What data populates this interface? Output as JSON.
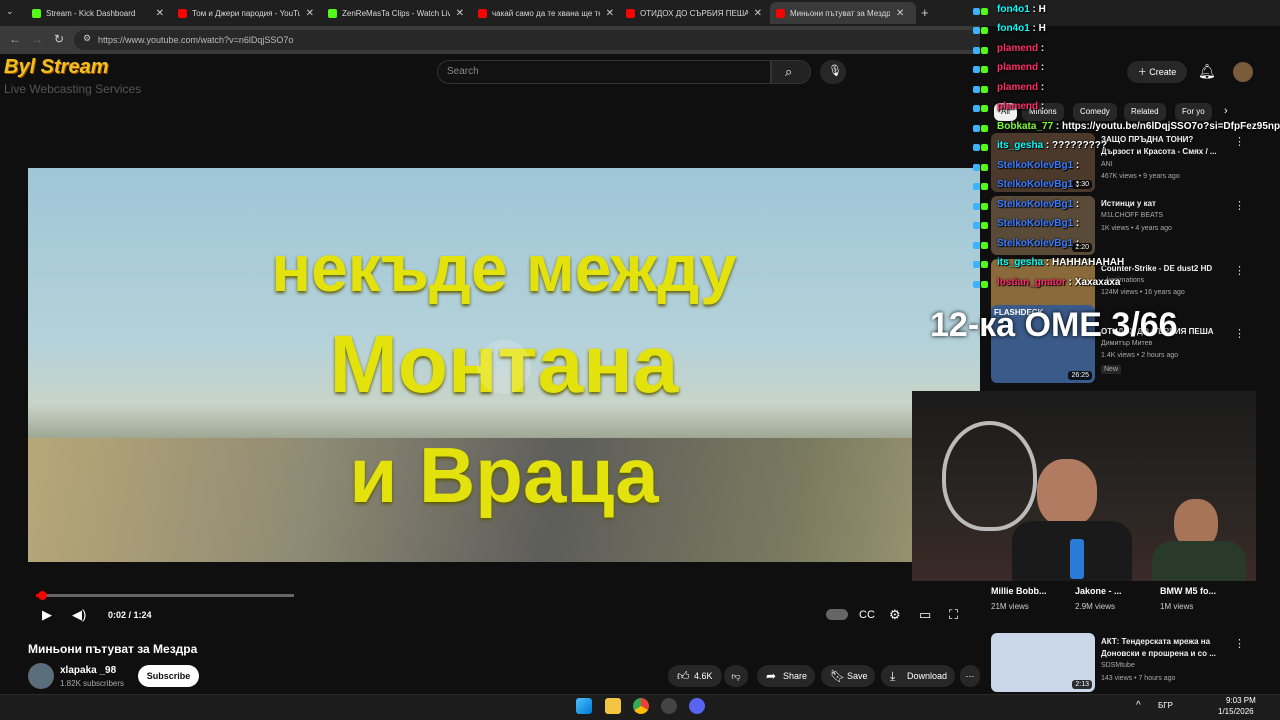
{
  "browser": {
    "tabs": [
      {
        "title": "Stream - Kick Dashboard",
        "color": "#53fc18"
      },
      {
        "title": "Том и Джери пародия - YouTube",
        "color": "#ff0000"
      },
      {
        "title": "ZenReMasTa Clips - Watch Live",
        "color": "#53fc18"
      },
      {
        "title": "чакай само да те хвана ще те",
        "color": "#ff0000"
      },
      {
        "title": "ОТИДОХ ДО СЪРБИЯ ПЕША -",
        "color": "#ff0000"
      },
      {
        "title": "Миньони пътуват за Мездра",
        "color": "#ff0000"
      }
    ],
    "url": "https://www.youtube.com/watch?v=n6lDqjSSO7o"
  },
  "youtube": {
    "search_placeholder": "Search",
    "create_label": "Create",
    "chips": [
      "All",
      "Minions",
      "Comedy",
      "Related",
      "For yo"
    ]
  },
  "video": {
    "overlay_lines": [
      "некъде между",
      "Монтана",
      "и Враца"
    ],
    "time": "0:02 / 1:24",
    "progress": 0.024,
    "title": "Миньони пътуват за Мездра",
    "channel": "xlapaka _98",
    "subscribers": "1.82K subscribers",
    "subscribe_label": "Subscribe",
    "likes": "4.6K",
    "share_label": "Share",
    "save_label": "Save",
    "download_label": "Download"
  },
  "related": [
    {
      "title": "ЗАЩО ПРЪДНА ТОНИ?",
      "title2": "Дързост и Красота - Смях / ...",
      "channel": "ANI",
      "meta": "467K views • 9 years ago",
      "duration": "3:30"
    },
    {
      "title": "Истинци у кат",
      "channel": "M1LCHOFF BEATS",
      "meta": "1K views • 4 years ago",
      "duration": "2:20"
    },
    {
      "title": "Counter-Strike - DE dust2 HD",
      "channel": "...kanimations",
      "meta": "124M views • 16 years ago",
      "duration": ""
    },
    {
      "title": "ОТИДОХ ДО СЪРБИЯ ПЕША",
      "channel": "Димитър Митев",
      "meta": "1.4K views • 2 hours ago",
      "badge": "New",
      "duration": "26:25",
      "thumb_text": "FLASHDECK"
    },
    {
      "title": "АКТ: Тендерската мрежа на",
      "title2": "Доновски е прошрена и со ...",
      "channel": "SDSMtube",
      "meta": "143 views • 7 hours ago",
      "duration": "2:13"
    }
  ],
  "shorts": [
    {
      "title": "Millie Bobb...",
      "views": "21M views"
    },
    {
      "title": "Jakone - ...",
      "views": "2.9M views"
    },
    {
      "title": "BMW M5 fo...",
      "views": "1M views"
    }
  ],
  "chat": [
    {
      "user": "fon4o1",
      "msg": "H",
      "color": "#00ffff"
    },
    {
      "user": "fon4o1",
      "msg": "H",
      "color": "#00ffff"
    },
    {
      "user": "plamend",
      "msg": "",
      "color": "#ff2b6b"
    },
    {
      "user": "plamend",
      "msg": "",
      "color": "#ff2b6b"
    },
    {
      "user": "plamend",
      "msg": "",
      "color": "#ff2b6b"
    },
    {
      "user": "plamend",
      "msg": "",
      "color": "#ff2b6b"
    },
    {
      "user": "Bobkata_77",
      "msg": "https://youtu.be/n6lDqjSSO7o?si=DfpFez95np",
      "color": "#7cfc3a"
    },
    {
      "user": "its_gesha",
      "msg": "?????????",
      "color": "#00ffff"
    },
    {
      "user": "StelkoKolevBg1",
      "msg": "",
      "color": "#3b7bff"
    },
    {
      "user": "StelkoKolevBg1",
      "msg": "",
      "color": "#3b7bff"
    },
    {
      "user": "StelkoKolevBg1",
      "msg": "",
      "color": "#3b7bff"
    },
    {
      "user": "StelkoKolevBg1",
      "msg": "",
      "color": "#3b7bff"
    },
    {
      "user": "StelkoKolevBg1",
      "msg": "",
      "color": "#3b7bff"
    },
    {
      "user": "its_gesha",
      "msg": "НАННАНАНАН",
      "color": "#00ffff"
    },
    {
      "user": "lostian_gnator",
      "msg": "Хахахаха",
      "color": "#ff2b6b"
    }
  ],
  "stream_overlay": {
    "logo_text": "Byl Stream",
    "logo_sub": "Live Webcasting Services",
    "counter": "12-ка ОМЕ 3/66"
  },
  "taskbar": {
    "lang": "БГР",
    "time": "9:03 PM",
    "date": "1/15/2026"
  },
  "colors": {
    "youtube_red": "#ff0000",
    "kick_green": "#53fc18",
    "overlay_yellow": "#e4e20c"
  }
}
